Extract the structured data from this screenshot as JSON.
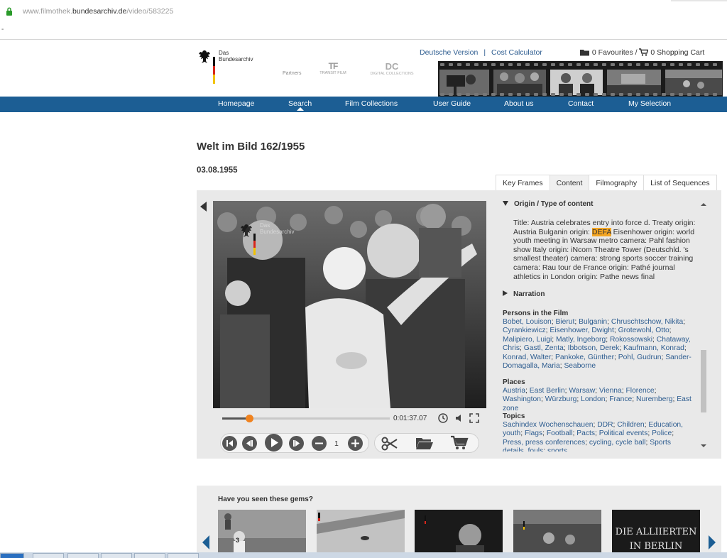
{
  "browser": {
    "url_pre": "www.filmothek.",
    "url_domain": "bundesarchiv.de",
    "url_path": "/video/583225",
    "dash": "-"
  },
  "header": {
    "logo_line1": "Das",
    "logo_line2": "Bundesarchiv",
    "partners_label": "Partners",
    "partner1_big": "TF",
    "partner1_small": "TRANSIT FILM",
    "partner2_big": "DC",
    "partner2_small": "DIGITAL COLLECTIONS",
    "link_german": "Deutsche Version",
    "link_sep": "|",
    "link_cost": "Cost Calculator",
    "favourites": "0 Favourites /",
    "cart": "0 Shopping Cart"
  },
  "nav": {
    "items": [
      "Homepage",
      "Search",
      "Film Collections",
      "User Guide",
      "About us",
      "Contact",
      "My Selection"
    ],
    "active": "Search"
  },
  "page": {
    "title": "Welt im Bild 162/1955",
    "date": "03.08.1955"
  },
  "tabs": [
    "Key Frames",
    "Content",
    "Filmography",
    "List of Sequences"
  ],
  "player": {
    "timecode": "0:01:37.07",
    "progress_fraction": 0.16,
    "speed": "1",
    "watermark_line1": "Das",
    "watermark_line2": "Bundesarchiv"
  },
  "content": {
    "origin_heading": "Origin / Type of content",
    "origin_before": "Title: Austria celebrates entry into force d. Treaty origin: Austria Bulganin origin: ",
    "origin_highlight": "DEFA",
    "origin_after": " Eisenhower origin: world youth meeting in Warsaw metro camera: Pahl fashion show Italy origin: iNcom Theatre Tower (Deutschld. 's smallest theater) camera: strong sports soccer training camera: Rau tour de France origin: Pathé journal athletics in London origin: Pathe news final",
    "narration_heading": "Narration",
    "persons_heading": "Persons in the Film",
    "persons": [
      "Bobet, Louison",
      "Bierut",
      "Bulganin",
      "Chruschtschow, Nikita",
      "Cyrankiewicz",
      "Eisenhower, Dwight",
      "Grotewohl, Otto",
      "Malipiero, Luigi",
      "Matly, Ingeborg",
      "Rokossowski",
      "Chataway, Chris",
      "Gastl, Zenta",
      "Ibbotson, Derek",
      "Kaufmann, Konrad",
      "Konrad, Walter",
      "Pankoke, Günther",
      "Pohl, Gudrun",
      "Sander-Domagalla, Maria",
      "Seaborne"
    ],
    "places_heading": "Places",
    "places": [
      "Austria",
      "East Berlin",
      "Warsaw",
      "Vienna",
      "Florence",
      "Washington",
      "Würzburg",
      "London",
      "France",
      "Nuremberg",
      "East zone"
    ],
    "topics_heading": "Topics",
    "topics": [
      "Sachindex Wochenschauen",
      "DDR",
      "Children",
      "Education, youth",
      "Flags",
      "Football",
      "Pacts",
      "Political events",
      "Police",
      "Press, press conferences",
      "cycling, cycle ball",
      "Sports details, fouls",
      "sports"
    ]
  },
  "gems": {
    "heading": "Have you seen these gems?",
    "thumb5_text_line1": "DIE ALLIIERTEN",
    "thumb5_text_line2": "IN BERLIN",
    "thumb1_number": "3"
  },
  "colors": {
    "nav_blue": "#1c5e94",
    "link_blue": "#2e5d90",
    "highlight": "#f5a623",
    "progress_knob": "#f0821e"
  }
}
